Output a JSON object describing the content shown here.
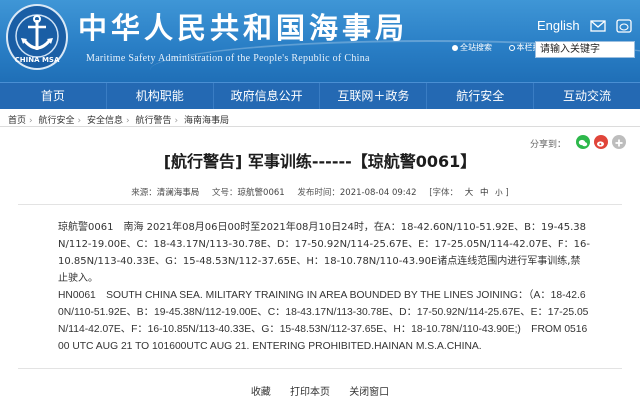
{
  "header": {
    "emblem_text": "CHINA MSA",
    "site_title": "中华人民共和国海事局",
    "site_subtitle": "Maritime Safety Administration of the People's Republic of China",
    "lang_link": "English",
    "search_radio_1": "全站搜索",
    "search_radio_2": "本栏搜索",
    "search_placeholder": "请输入关键字"
  },
  "nav": [
    "首页",
    "机构职能",
    "政府信息公开",
    "互联网＋政务",
    "航行安全",
    "互动交流"
  ],
  "breadcrumb": [
    "首页",
    "航行安全",
    "安全信息",
    "航行警告",
    "海南海事局"
  ],
  "share": {
    "label": "分享到："
  },
  "article": {
    "title": "[航行警告] 军事训练------【琼航警0061】",
    "meta": {
      "source_label": "来源：",
      "source_value": "清澜海事局",
      "doc_label": "文号：",
      "doc_value": "琼航警0061",
      "date_label": "发布时间：",
      "date_value": "2021-08-04 09:42",
      "font_label": "[字体：",
      "font_large": "大",
      "font_medium": "中",
      "font_small": "小",
      "font_close": "]"
    },
    "paragraph_cn": "琼航警0061　南海 2021年08月06日00时至2021年08月10日24时，在A：18-42.60N/110-51.92E、B：19-45.38N/112-19.00E、C：18-43.17N/113-30.78E、D：17-50.92N/114-25.67E、E：17-25.05N/114-42.07E、F：16-10.85N/113-40.33E、G：15-48.53N/112-37.65E、H：18-10.78N/110-43.90E诸点连线范围内进行军事训练,禁止驶入。",
    "paragraph_en": "HN0061　SOUTH CHINA SEA. MILITARY TRAINING IN AREA BOUNDED BY THE LINES JOINING：（A：18-42.60N/110-51.92E、B：19-45.38N/112-19.00E、C：18-43.17N/113-30.78E、D：17-50.92N/114-25.67E、E：17-25.05N/114-42.07E、F：16-10.85N/113-40.33E、G：15-48.53N/112-37.65E、H：18-10.78N/110-43.90E;)　FROM 051600 UTC AUG 21 TO 101600UTC AUG 21. ENTERING PROHIBITED.HAINAN M.S.A.CHINA."
  },
  "footer": [
    "收藏",
    "打印本页",
    "关闭窗口"
  ],
  "colors": {
    "header_blue": "#2a7fc6",
    "nav_blue": "#2469b3",
    "share_green": "#2db84b",
    "share_red": "#e0453a"
  }
}
